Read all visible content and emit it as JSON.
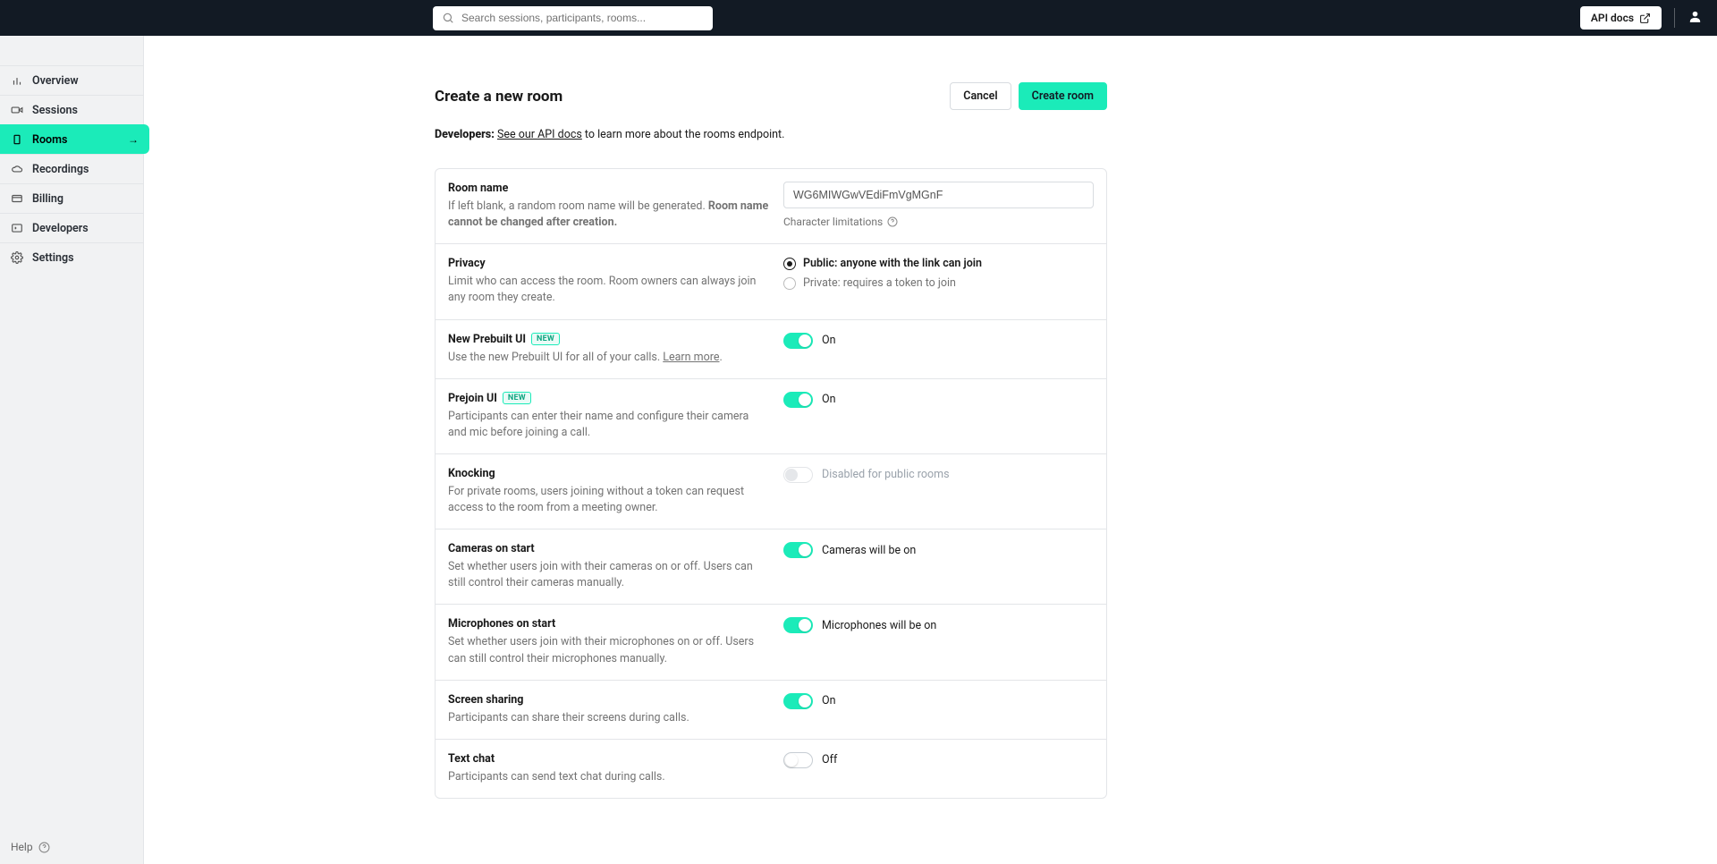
{
  "search_placeholder": "Search sessions, participants, rooms...",
  "api_docs_btn": "API docs",
  "sidebar": {
    "items": [
      {
        "label": "Overview"
      },
      {
        "label": "Sessions"
      },
      {
        "label": "Rooms"
      },
      {
        "label": "Recordings"
      },
      {
        "label": "Billing"
      },
      {
        "label": "Developers"
      },
      {
        "label": "Settings"
      }
    ],
    "help": "Help"
  },
  "page": {
    "title": "Create a new room",
    "cancel": "Cancel",
    "create": "Create room",
    "dev_prefix": "Developers:",
    "dev_link": "See our API docs",
    "dev_suffix": " to learn more about the rooms endpoint."
  },
  "rows": {
    "room_name": {
      "title": "Room name",
      "desc1": "If left blank, a random room name will be generated. ",
      "desc2": "Room name cannot be changed after creation.",
      "value": "WG6MIWGwVEdiFmVgMGnF",
      "hint": "Character limitations"
    },
    "privacy": {
      "title": "Privacy",
      "desc": "Limit who can access the room. Room owners can always join any room they create.",
      "public": "Public: anyone with the link can join",
      "private": "Private: requires a token to join"
    },
    "prebuilt": {
      "title": "New Prebuilt UI",
      "badge": "NEW",
      "desc1": "Use the new Prebuilt UI for all of your calls. ",
      "learn": "Learn more",
      "state": "On"
    },
    "prejoin": {
      "title": "Prejoin UI",
      "badge": "NEW",
      "desc": "Participants can enter their name and configure their camera and mic before joining a call.",
      "state": "On"
    },
    "knocking": {
      "title": "Knocking",
      "desc": "For private rooms, users joining without a token can request access to the room from a meeting owner.",
      "state": "Disabled for public rooms"
    },
    "cameras": {
      "title": "Cameras on start",
      "desc": "Set whether users join with their cameras on or off. Users can still control their cameras manually.",
      "state": "Cameras will be on"
    },
    "mics": {
      "title": "Microphones on start",
      "desc": "Set whether users join with their microphones on or off. Users can still control their microphones manually.",
      "state": "Microphones will be on"
    },
    "screen": {
      "title": "Screen sharing",
      "desc": "Participants can share their screens during calls.",
      "state": "On"
    },
    "chat": {
      "title": "Text chat",
      "desc": "Participants can send text chat during calls.",
      "state": "Off"
    }
  }
}
